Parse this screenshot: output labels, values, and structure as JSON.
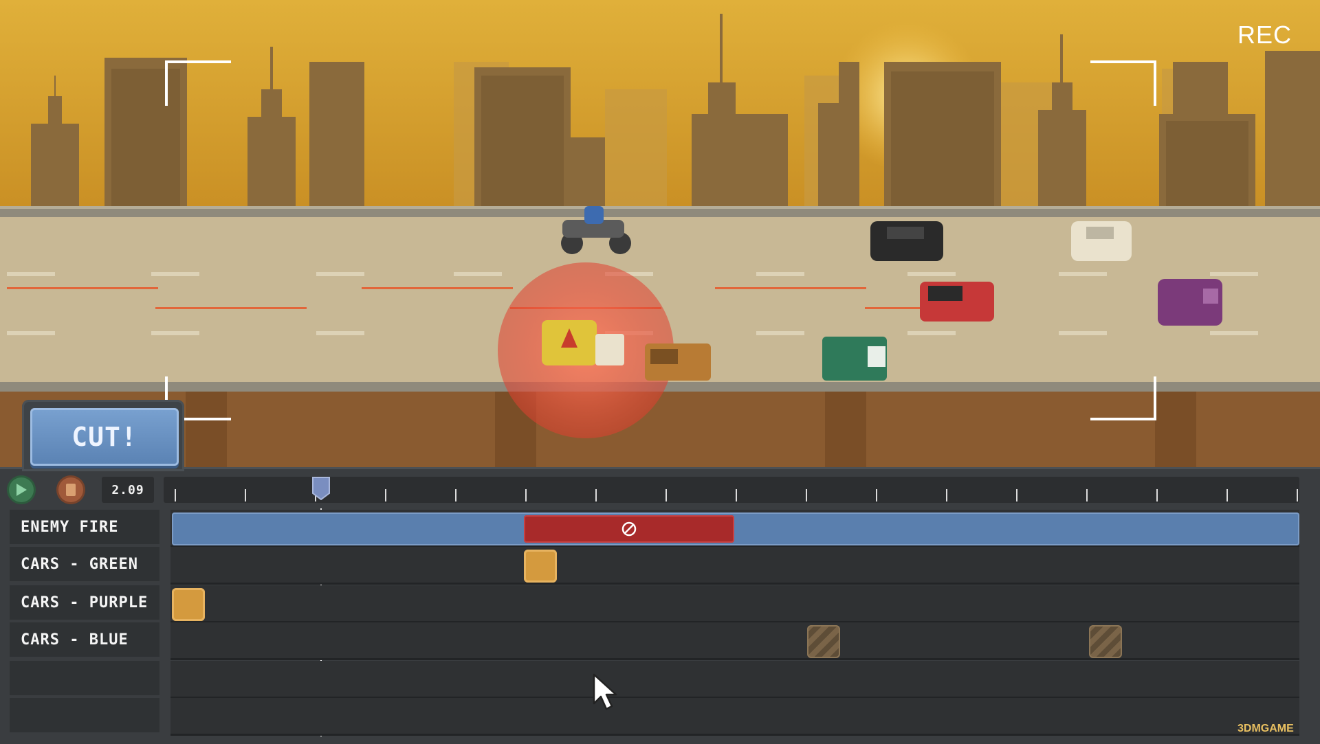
{
  "hud": {
    "rec_label": "REC"
  },
  "cut_button": {
    "label": "CUT!"
  },
  "controls": {
    "time": "2.09",
    "play_icon": "play-icon",
    "record_icon": "record-icon"
  },
  "tracks": [
    {
      "label": "ENEMY FIRE"
    },
    {
      "label": "CARS - GREEN"
    },
    {
      "label": "CARS - PURPLE"
    },
    {
      "label": "CARS - BLUE"
    },
    {
      "label": ""
    },
    {
      "label": ""
    }
  ],
  "colors": {
    "sky": "#d7a42e",
    "road": "#c8b895",
    "enemy_track": "#5a7fae",
    "blocked_segment": "#a82a2a",
    "clip": "#d49a3e",
    "explosion": "#e05a45"
  },
  "watermark": {
    "text": "3DMGAME"
  }
}
